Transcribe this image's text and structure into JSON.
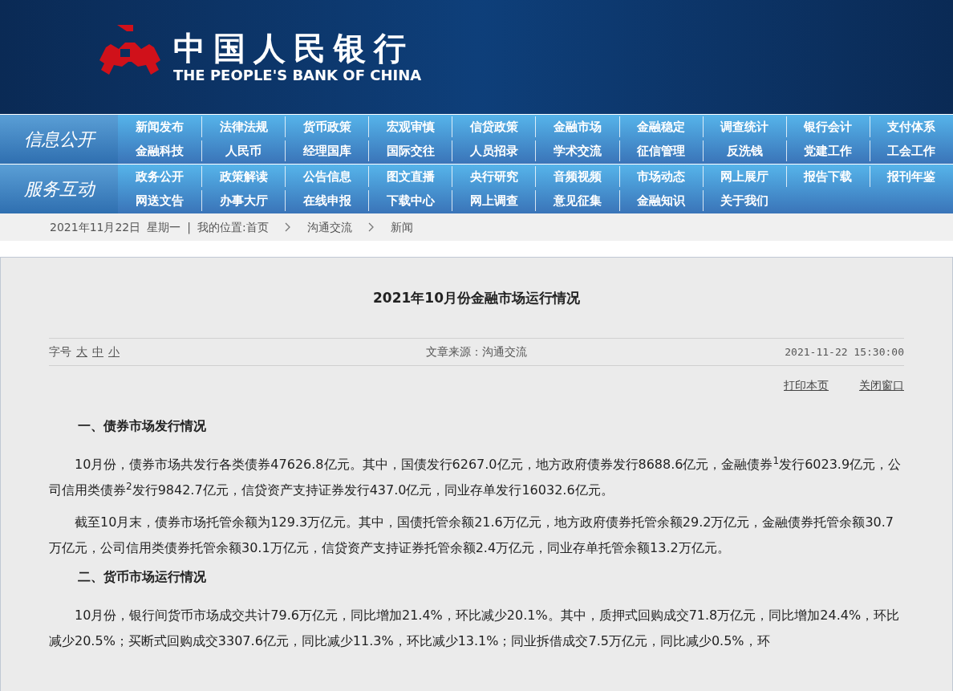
{
  "header": {
    "title_cn": "中国人民银行",
    "title_en": "THE PEOPLE'S BANK OF CHINA"
  },
  "nav": [
    {
      "label": "信息公开",
      "rows": [
        [
          "新闻发布",
          "法律法规",
          "货币政策",
          "宏观审慎",
          "信贷政策",
          "金融市场",
          "金融稳定",
          "调查统计",
          "银行会计",
          "支付体系"
        ],
        [
          "金融科技",
          "人民币",
          "经理国库",
          "国际交往",
          "人员招录",
          "学术交流",
          "征信管理",
          "反洗钱",
          "党建工作",
          "工会工作"
        ]
      ]
    },
    {
      "label": "服务互动",
      "rows": [
        [
          "政务公开",
          "政策解读",
          "公告信息",
          "图文直播",
          "央行研究",
          "音频视频",
          "市场动态",
          "网上展厅",
          "报告下载",
          "报刊年鉴"
        ],
        [
          "网送文告",
          "办事大厅",
          "在线申报",
          "下载中心",
          "网上调查",
          "意见征集",
          "金融知识",
          "关于我们"
        ]
      ]
    }
  ],
  "breadcrumb": {
    "date": "2021年11月22日",
    "weekday": "星期一",
    "separator": "|",
    "location_label": "我的位置:",
    "items": [
      "首页",
      "沟通交流",
      "新闻"
    ]
  },
  "article": {
    "title": "2021年10月份金融市场运行情况",
    "font_size_label": "字号",
    "font_sizes": [
      "大",
      "中",
      "小"
    ],
    "source": "文章来源：沟通交流",
    "datetime": "2021-11-22 15:30:00",
    "actions": [
      "打印本页",
      "关闭窗口"
    ],
    "blocks": [
      {
        "kind": "heading",
        "text": "一、债券市场发行情况"
      },
      {
        "kind": "paragraph",
        "text": "10月份，债券市场共发行各类债券47626.8亿元。其中，国债发行6267.0亿元，地方政府债券发行8688.6亿元，金融债券$^{1}$发行6023.9亿元，公司信用类债券$^{2}$发行9842.7亿元，信贷资产支持证券发行437.0亿元，同业存单发行16032.6亿元。"
      },
      {
        "kind": "paragraph",
        "text": "截至10月末，债券市场托管余额为129.3万亿元。其中，国债托管余额21.6万亿元，地方政府债券托管余额29.2万亿元，金融债券托管余额30.7万亿元，公司信用类债券托管余额30.1万亿元，信贷资产支持证券托管余额2.4万亿元，同业存单托管余额13.2万亿元。"
      },
      {
        "kind": "heading",
        "text": "二、货币市场运行情况"
      },
      {
        "kind": "paragraph",
        "text": "10月份，银行间货币市场成交共计79.6万亿元，同比增加21.4%，环比减少20.1%。其中，质押式回购成交71.8万亿元，同比增加24.4%，环比减少20.5%；买断式回购成交3307.6亿元，同比减少11.3%，环比减少13.1%；同业拆借成交7.5万亿元，同比减少0.5%，环"
      }
    ]
  }
}
